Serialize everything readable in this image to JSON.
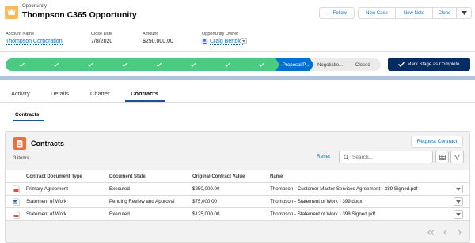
{
  "record": {
    "type_label": "Opportunity",
    "name": "Thompson C365 Opportunity"
  },
  "actions": {
    "follow": "Follow",
    "new_case": "New Case",
    "new_note": "New Note",
    "clone": "Clone"
  },
  "highlights": [
    {
      "label": "Account Name",
      "value": "Thompson Corporation"
    },
    {
      "label": "Close Date",
      "value": "7/8/2020"
    },
    {
      "label": "Amount",
      "value": "$250,000.00"
    },
    {
      "label": "Opportunity Owner",
      "value": "Craig Bertoldi"
    }
  ],
  "path": {
    "stages": [
      "",
      "",
      "",
      "",
      "",
      "",
      "",
      "",
      "Proposal/P...",
      "Negotiatio...",
      "Closed"
    ],
    "current_index": 8,
    "completed_color": "#4bca81",
    "current_color": "#0070d2",
    "incomplete_color": "#ecebea",
    "mark_complete_label": "Mark Stage as Complete"
  },
  "tabs": [
    "Activity",
    "Details",
    "Chatter",
    "Contracts"
  ],
  "active_tab": "Contracts",
  "subtab": "Contracts",
  "related_list": {
    "title": "Contracts",
    "request_button": "Request Contract",
    "item_count": "3 items",
    "reset_label": "Reset",
    "search_placeholder": "Search...",
    "columns": [
      "Contract Document Type",
      "Document State",
      "Original Contract Value",
      "Name"
    ],
    "rows": [
      {
        "icon": "pdf-file-icon",
        "type": "Primary Agreement",
        "state": "Executed",
        "value": "$250,000.00",
        "name": "Thompson - Customer Master Services Agreement - 389 Signed.pdf"
      },
      {
        "icon": "word-file-icon",
        "type": "Statement of Work",
        "state": "Pending Review and Approval",
        "value": "$75,000.00",
        "name": "Thompson - Statement of Work - 399.docx"
      },
      {
        "icon": "pdf-file-icon",
        "type": "Statement of Work",
        "state": "Executed",
        "value": "$125,000.00",
        "name": "Thompson - Statement of Work - 398 Signed.pdf"
      }
    ]
  }
}
